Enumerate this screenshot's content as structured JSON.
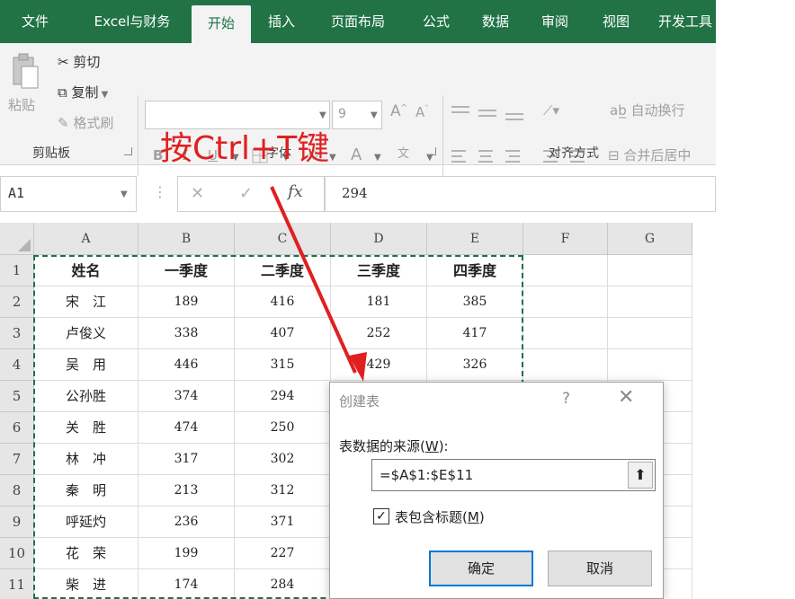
{
  "tabs": [
    "文件",
    "Excel与财务",
    "开始",
    "插入",
    "页面布局",
    "公式",
    "数据",
    "审阅",
    "视图",
    "开发工具"
  ],
  "active_tab": "开始",
  "clipboard": {
    "cut": "剪切",
    "copy": "复制",
    "paste": "粘贴",
    "format_painter": "格式刷",
    "group_label": "剪贴板"
  },
  "font": {
    "font_name": "",
    "font_size": "9",
    "group_label": "字体",
    "bold": "B",
    "italic": "I",
    "underline": "U",
    "font_color": "A",
    "grow": "A",
    "shrink": "A",
    "phonetic": "文"
  },
  "alignment": {
    "wrap_text": "自动换行",
    "merge_center": "合并后居中",
    "group_label": "对齐方式"
  },
  "annotation": "按Ctrl+T键",
  "formula_bar": {
    "name_box": "A1",
    "fx": "fx",
    "formula": "294"
  },
  "columns": [
    "A",
    "B",
    "C",
    "D",
    "E",
    "F",
    "G"
  ],
  "rows": [
    "1",
    "2",
    "3",
    "4",
    "5",
    "6",
    "7",
    "8",
    "9",
    "10",
    "11"
  ],
  "table": [
    [
      "姓名",
      "一季度",
      "二季度",
      "三季度",
      "四季度"
    ],
    [
      "宋　江",
      "189",
      "416",
      "181",
      "385"
    ],
    [
      "卢俊义",
      "338",
      "407",
      "252",
      "417"
    ],
    [
      "吴　用",
      "446",
      "315",
      "429",
      "326"
    ],
    [
      "公孙胜",
      "374",
      "294",
      "",
      ""
    ],
    [
      "关　胜",
      "474",
      "250",
      "",
      ""
    ],
    [
      "林　冲",
      "317",
      "302",
      "",
      ""
    ],
    [
      "秦　明",
      "213",
      "312",
      "",
      ""
    ],
    [
      "呼延灼",
      "236",
      "371",
      "",
      ""
    ],
    [
      "花　荣",
      "199",
      "227",
      "",
      ""
    ],
    [
      "柴　进",
      "174",
      "284",
      "",
      ""
    ]
  ],
  "dialog": {
    "title": "创建表",
    "help": "?",
    "close": "✕",
    "source_label_prefix": "表数据的来源(",
    "source_label_key": "W",
    "source_label_suffix": "):",
    "range": "=$A$1:$E$11",
    "collapse_icon": "collapse-range-icon",
    "has_headers_prefix": "表包含标题(",
    "has_headers_key": "M",
    "has_headers_suffix": ")",
    "has_headers_checked": true,
    "ok": "确定",
    "cancel": "取消"
  },
  "colors": {
    "ribbon_green": "#217346",
    "annotation_red": "#e02020",
    "ok_border": "#0078d7"
  }
}
